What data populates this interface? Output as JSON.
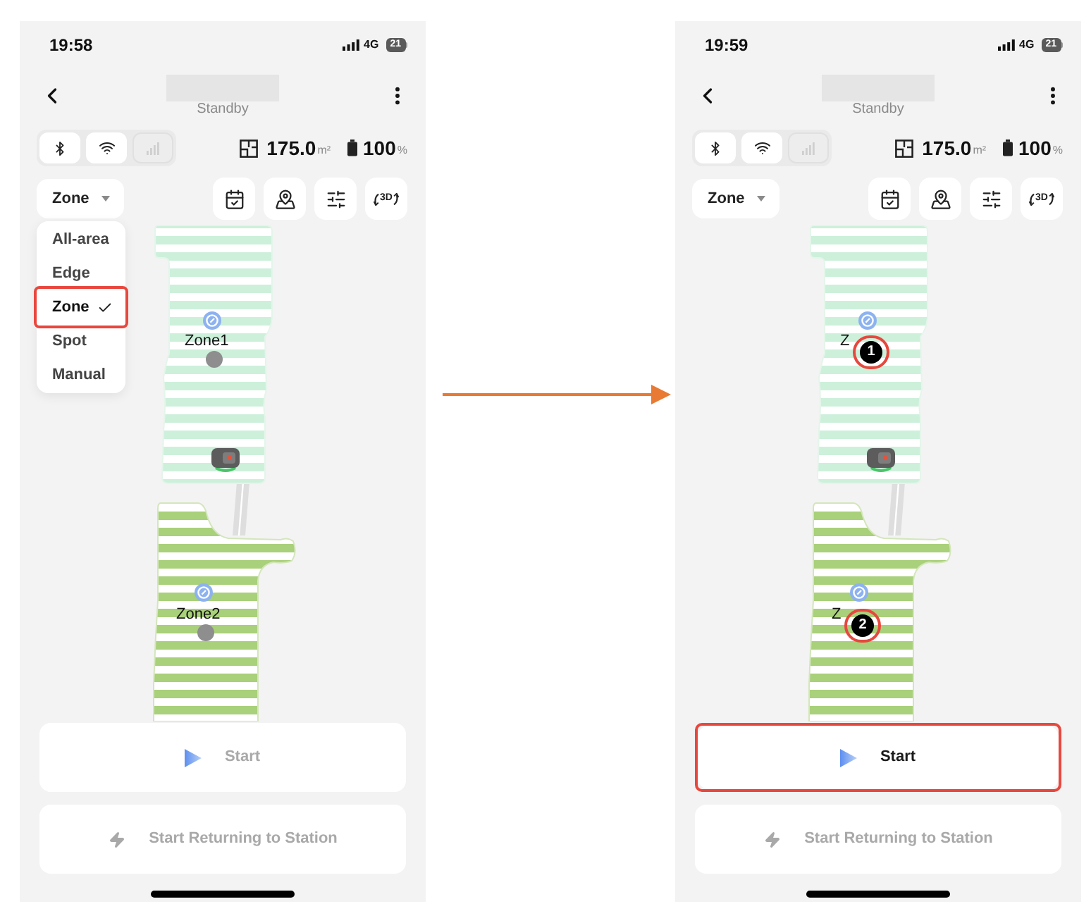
{
  "phones": [
    {
      "status_bar": {
        "time": "19:58",
        "network": "4G",
        "battery": "21"
      },
      "header": {
        "status": "Standby"
      },
      "connectivity": [
        {
          "kind": "bluetooth",
          "on": true
        },
        {
          "kind": "wifi",
          "on": true
        },
        {
          "kind": "cellular",
          "on": false
        }
      ],
      "stats": {
        "area": "175.0",
        "area_unit": "m²",
        "battery": "100",
        "battery_unit": "%"
      },
      "mode_select": {
        "value": "Zone",
        "options": [
          {
            "label": "All-area",
            "selected": false,
            "highlighted": false
          },
          {
            "label": "Edge",
            "selected": false,
            "highlighted": false
          },
          {
            "label": "Zone",
            "selected": true,
            "highlighted": true
          },
          {
            "label": "Spot",
            "selected": false,
            "highlighted": false
          },
          {
            "label": "Manual",
            "selected": false,
            "highlighted": false
          }
        ]
      },
      "toolbar": [
        {
          "kind": "schedule"
        },
        {
          "kind": "map"
        },
        {
          "kind": "settings"
        },
        {
          "kind": "view3d",
          "label": "3D"
        }
      ],
      "map": {
        "zones": [
          {
            "label": "Zone1",
            "selected": false,
            "circled": false
          },
          {
            "label": "Zone2",
            "selected": false,
            "circled": false
          }
        ]
      },
      "actions": [
        {
          "kind": "start",
          "label": "Start",
          "disabled": true,
          "highlighted": false
        },
        {
          "kind": "return",
          "label": "Start Returning to Station",
          "disabled": true,
          "highlighted": false
        }
      ]
    },
    {
      "status_bar": {
        "time": "19:59",
        "network": "4G",
        "battery": "21"
      },
      "header": {
        "status": "Standby"
      },
      "connectivity": [
        {
          "kind": "bluetooth",
          "on": true
        },
        {
          "kind": "wifi",
          "on": true
        },
        {
          "kind": "cellular",
          "on": false
        }
      ],
      "stats": {
        "area": "175.0",
        "area_unit": "m²",
        "battery": "100",
        "battery_unit": "%"
      },
      "mode_select": {
        "value": "Zone"
      },
      "toolbar": [
        {
          "kind": "schedule"
        },
        {
          "kind": "map"
        },
        {
          "kind": "settings"
        },
        {
          "kind": "view3d",
          "label": "3D"
        }
      ],
      "map": {
        "zones": [
          {
            "label": "Z",
            "selected": true,
            "order": "1",
            "circled": true
          },
          {
            "label": "Z",
            "selected": true,
            "order": "2",
            "circled": true
          }
        ]
      },
      "actions": [
        {
          "kind": "start",
          "label": "Start",
          "disabled": false,
          "highlighted": true
        },
        {
          "kind": "return",
          "label": "Start Returning to Station",
          "disabled": true,
          "highlighted": false
        }
      ]
    }
  ]
}
